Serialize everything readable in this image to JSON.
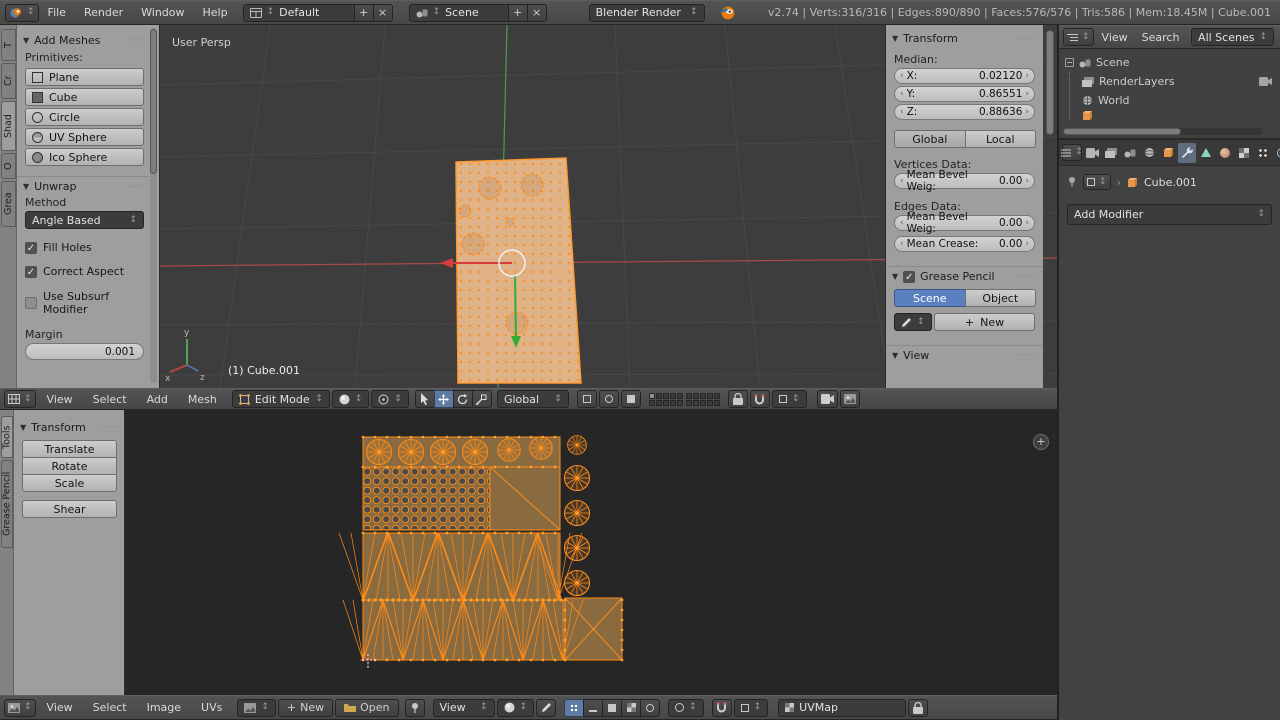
{
  "topbar": {
    "menus": [
      "File",
      "Render",
      "Window",
      "Help"
    ],
    "layout": {
      "value": "Default",
      "add": "+",
      "close": "×"
    },
    "scene": {
      "value": "Scene",
      "add": "+",
      "close": "×"
    },
    "engine": "Blender Render",
    "stats": "v2.74 | Verts:316/316 | Edges:890/890 | Faces:576/576 | Tris:586 | Mem:18.45M | Cube.001"
  },
  "tool_shelf": {
    "tabs": [
      "T",
      "Cr",
      "Shad",
      "O",
      "Grea"
    ],
    "add_meshes": {
      "title": "Add Meshes",
      "subtitle": "Primitives:",
      "buttons": [
        "Plane",
        "Cube",
        "Circle",
        "UV Sphere",
        "Ico Sphere"
      ]
    },
    "unwrap": {
      "title": "Unwrap",
      "method_label": "Method",
      "method": "Angle Based",
      "checks": [
        {
          "label": "Fill Holes",
          "on": true
        },
        {
          "label": "Correct Aspect",
          "on": true
        },
        {
          "label": "Use Subsurf Modifier",
          "on": false
        }
      ],
      "margin_label": "Margin",
      "margin": "0.001"
    }
  },
  "viewport": {
    "view_label": "User Persp",
    "object_label": "(1) Cube.001",
    "axis_x": "x",
    "axis_y": "y",
    "axis_z": "z"
  },
  "npanel": {
    "transform": {
      "title": "Transform",
      "median_label": "Median:",
      "x_label": "X:",
      "x": "0.02120",
      "y_label": "Y:",
      "y": "0.86551",
      "z_label": "Z:",
      "z": "0.88636",
      "global": "Global",
      "local": "Local",
      "vertices_label": "Vertices Data:",
      "vert_bevel_label": "Mean Bevel Weig:",
      "vert_bevel": "0.00",
      "edges_label": "Edges Data:",
      "edge_bevel_label": "Mean Bevel Weig:",
      "edge_bevel": "0.00",
      "crease_label": "Mean Crease:",
      "crease": "0.00"
    },
    "grease_pencil": {
      "title": "Grease Pencil",
      "scene": "Scene",
      "object": "Object",
      "new": "New"
    },
    "view_title": "View"
  },
  "header_3d": {
    "menus": [
      "View",
      "Select",
      "Add",
      "Mesh"
    ],
    "mode": "Edit Mode",
    "orientation": "Global"
  },
  "uv_tools": {
    "tabs": [
      "Tools",
      "Grease Pencil"
    ],
    "transform_title": "Transform",
    "buttons": [
      "Translate",
      "Rotate",
      "Scale",
      "Shear"
    ]
  },
  "header_uv": {
    "menus": [
      "View",
      "Select",
      "Image",
      "UVs"
    ],
    "new_button": "New",
    "open_button": "Open",
    "view_dd": "View",
    "uvmap": "UVMap"
  },
  "outliner": {
    "menus": [
      "View",
      "Search"
    ],
    "scenes_dd": "All Scenes",
    "items": [
      "Scene",
      "RenderLayers",
      "World"
    ]
  },
  "properties": {
    "object_name": "Cube.001",
    "add_modifier": "Add Modifier"
  }
}
